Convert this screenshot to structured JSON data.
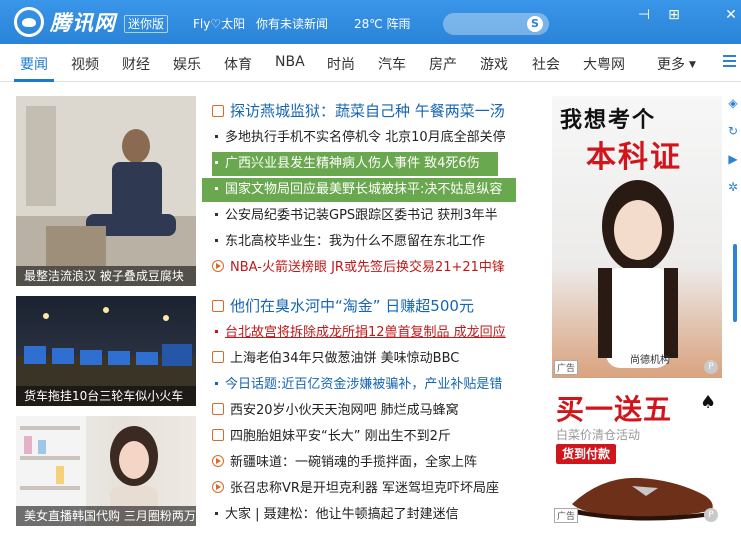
{
  "titlebar": {
    "logo_text": "腾讯网",
    "edition": "迷你版",
    "user": "Fly♡太阳",
    "notice": "你有未读新闻",
    "weather": "28℃ 阵雨",
    "search_placeholder": "",
    "search_icon": "S",
    "buttons": {
      "pin": "⊣",
      "maximize": "⊞",
      "close": "✕"
    }
  },
  "nav": {
    "items": [
      "要闻",
      "视频",
      "财经",
      "娱乐",
      "体育",
      "NBA",
      "时尚",
      "汽车",
      "房产",
      "游戏",
      "社会",
      "大粤网"
    ],
    "more": "更多",
    "active": "要闻",
    "accent": "#1a7ad0"
  },
  "photos": [
    {
      "caption": "最整洁流浪汉 被子叠成豆腐块"
    },
    {
      "caption": "货车拖挂10台三轮车似小火车"
    },
    {
      "caption": "美女直播韩国代购 三月圈粉两万"
    }
  ],
  "news": {
    "headline1": "探访燕城监狱：蔬菜自己种 午餐两菜一汤",
    "items1": [
      "多地执行手机不实名停机令 北京10月底全部关停",
      "广西兴业县发生精神病人伤人事件 致4死6伤",
      "国家文物局回应最美野长城被抹平:决不姑息纵容",
      "公安局纪委书记装GPS跟踪区委书记 获刑3年半",
      "东北高校毕业生：我为什么不愿留在东北工作"
    ],
    "video_item": "NBA-火箭送榜眼 JR或先签后换交易21+21中锋",
    "headline2": "他们在臭水河中“淘金” 日赚超500元",
    "red_item": "台北故宫将拆除成龙所捐12兽首复制品 成龙回应",
    "items2": [
      "上海老伯34年只做葱油饼 美味惊动BBC",
      "今日话题:近百亿资金涉嫌被骗补，产业补贴是错",
      "西安20岁小伙天天泡网吧 肺烂成马蜂窝",
      "四胞胎姐妹平安“长大” 刚出生不到2斤",
      "新疆味道：一碗销魂的手揽拌面，全家上阵",
      "张召忠称VR是开坦克利器 军迷驾坦克吓坏局座",
      "大家 | 聂建松：他让牛顿搞起了封建迷信"
    ]
  },
  "ads": {
    "ad1": {
      "line1": "我想考个",
      "line2": "本科证",
      "tag": "广告",
      "brand": "尚德机构"
    },
    "ad2": {
      "title": "买一送五",
      "subtitle": "白菜价清仓活动",
      "button": "货到付款",
      "tag": "广告"
    }
  },
  "colors": {
    "titlebar": "#2a83d8",
    "headline": "#1565b3",
    "red": "#c01818",
    "selected": "#6aa84f"
  }
}
